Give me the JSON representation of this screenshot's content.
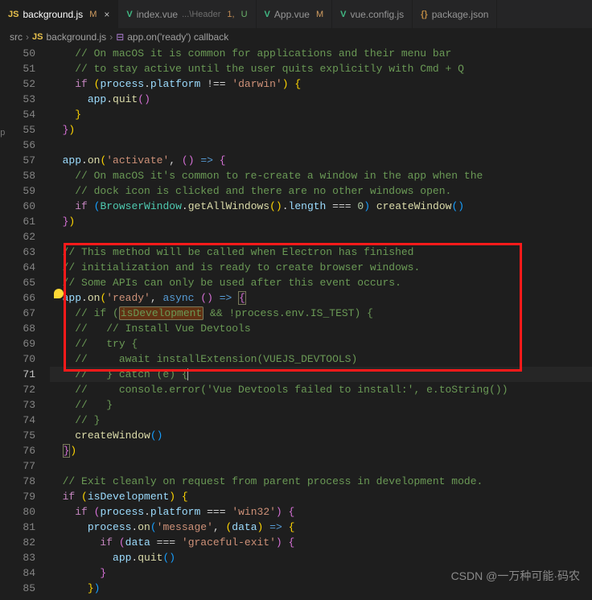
{
  "tabs": [
    {
      "icon": "JS",
      "name": "background.js",
      "badge": "M",
      "close": "×",
      "iconClass": "js-icon",
      "badgeClass": "M"
    },
    {
      "icon": "V",
      "name": "index.vue",
      "dim": "...\\Header",
      "num": "1,",
      "badge": "U",
      "iconClass": "vue-icon",
      "badgeClass": "U"
    },
    {
      "icon": "V",
      "name": "App.vue",
      "badge": "M",
      "iconClass": "vue-icon",
      "badgeClass": "M"
    },
    {
      "icon": "V",
      "name": "vue.config.js",
      "iconClass": "vue-icon"
    },
    {
      "icon": "{}",
      "name": "package.json",
      "iconClass": "json-icon"
    }
  ],
  "breadcrumbs": {
    "seg1": "src",
    "seg2_icon": "JS",
    "seg2": "background.js",
    "seg3_icon": "⊟",
    "seg3": "app.on('ready') callback"
  },
  "code": {
    "lines": [
      {
        "n": 50,
        "html": "    <span class='c-comment'>// On macOS it is common for applications and their menu bar</span>"
      },
      {
        "n": 51,
        "html": "    <span class='c-comment'>// to stay active until the user quits explicitly with Cmd + Q</span>"
      },
      {
        "n": 52,
        "html": "    <span class='c-keyword'>if</span> <span class='c-br'>(</span><span class='c-var'>process</span>.<span class='c-prop'>platform</span> !== <span class='c-string'>'darwin'</span><span class='c-br'>)</span> <span class='c-br'>{</span>"
      },
      {
        "n": 53,
        "html": "      <span class='c-var'>app</span>.<span class='c-func'>quit</span><span class='c-br2'>(</span><span class='c-br2'>)</span>"
      },
      {
        "n": 54,
        "html": "    <span class='c-br'>}</span>"
      },
      {
        "n": 55,
        "html": "  <span class='c-br2'>}</span><span class='c-br'>)</span>"
      },
      {
        "n": 56,
        "html": ""
      },
      {
        "n": 57,
        "html": "  <span class='c-var'>app</span>.<span class='c-func'>on</span><span class='c-br'>(</span><span class='c-string'>'activate'</span>, <span class='c-br2'>(</span><span class='c-br2'>)</span> <span class='c-const'>=&gt;</span> <span class='c-br2'>{</span>"
      },
      {
        "n": 58,
        "html": "    <span class='c-comment'>// On macOS it's common to re-create a window in the app when the</span>"
      },
      {
        "n": 59,
        "html": "    <span class='c-comment'>// dock icon is clicked and there are no other windows open.</span>"
      },
      {
        "n": 60,
        "html": "    <span class='c-keyword'>if</span> <span class='c-br3'>(</span><span class='c-obj'>BrowserWindow</span>.<span class='c-func'>getAllWindows</span><span class='c-br'>(</span><span class='c-br'>)</span>.<span class='c-prop'>length</span> === <span class='c-num'>0</span><span class='c-br3'>)</span> <span class='c-func'>createWindow</span><span class='c-br3'>(</span><span class='c-br3'>)</span>"
      },
      {
        "n": 61,
        "html": "  <span class='c-br2'>}</span><span class='c-br'>)</span>"
      },
      {
        "n": 62,
        "html": ""
      },
      {
        "n": 63,
        "html": "  <span class='c-comment'>// This method will be called when Electron has finished</span>"
      },
      {
        "n": 64,
        "html": "  <span class='c-comment'>// initialization and is ready to create browser windows.</span>"
      },
      {
        "n": 65,
        "html": "  <span class='c-comment'>// Some APIs can only be used after this event occurs.</span>"
      },
      {
        "n": 66,
        "html": "  <span class='c-var'>app</span>.<span class='c-func'>on</span><span class='c-br'>(</span><span class='c-string'>'ready'</span>, <span class='c-const'>async</span> <span class='c-br2'>(</span><span class='c-br2'>)</span> <span class='c-const'>=&gt;</span> <span class='c-br2' style='border:1px solid #7a7a5a;'>{</span>"
      },
      {
        "n": 67,
        "html": "    <span class='c-comment'>// if (<span class='hl-box'>isDevelopment</span> && !process.env.IS_TEST) {</span>"
      },
      {
        "n": 68,
        "html": "    <span class='c-comment'>//   // Install Vue Devtools</span>"
      },
      {
        "n": 69,
        "html": "    <span class='c-comment'>//   try {</span>"
      },
      {
        "n": 70,
        "html": "    <span class='c-comment'>//     await installExtension(VUEJS_DEVTOOLS)</span>"
      },
      {
        "n": 71,
        "html": "    <span class='c-comment'>//   } catch (e) {</span><span class='cursor'></span>",
        "active": true
      },
      {
        "n": 72,
        "html": "    <span class='c-comment'>//     console.error('Vue Devtools failed to install:', e.toString())</span>"
      },
      {
        "n": 73,
        "html": "    <span class='c-comment'>//   }</span>"
      },
      {
        "n": 74,
        "html": "    <span class='c-comment'>// }</span>"
      },
      {
        "n": 75,
        "html": "    <span class='c-func'>createWindow</span><span class='c-br3'>(</span><span class='c-br3'>)</span>"
      },
      {
        "n": 76,
        "html": "  <span class='c-br2' style='border:1px solid #7a7a5a;'>}</span><span class='c-br'>)</span>"
      },
      {
        "n": 77,
        "html": ""
      },
      {
        "n": 78,
        "html": "  <span class='c-comment'>// Exit cleanly on request from parent process in development mode.</span>"
      },
      {
        "n": 79,
        "html": "  <span class='c-keyword'>if</span> <span class='c-br'>(</span><span class='c-var'>isDevelopment</span><span class='c-br'>)</span> <span class='c-br'>{</span>"
      },
      {
        "n": 80,
        "html": "    <span class='c-keyword'>if</span> <span class='c-br2'>(</span><span class='c-var'>process</span>.<span class='c-prop'>platform</span> === <span class='c-string'>'win32'</span><span class='c-br2'>)</span> <span class='c-br2'>{</span>"
      },
      {
        "n": 81,
        "html": "      <span class='c-var'>process</span>.<span class='c-func'>on</span><span class='c-br3'>(</span><span class='c-string'>'message'</span>, <span class='c-br'>(</span><span class='c-param'>data</span><span class='c-br'>)</span> <span class='c-const'>=&gt;</span> <span class='c-br'>{</span>"
      },
      {
        "n": 82,
        "html": "        <span class='c-keyword'>if</span> <span class='c-br2'>(</span><span class='c-var'>data</span> === <span class='c-string'>'graceful-exit'</span><span class='c-br2'>)</span> <span class='c-br2'>{</span>"
      },
      {
        "n": 83,
        "html": "          <span class='c-var'>app</span>.<span class='c-func'>quit</span><span class='c-br3'>(</span><span class='c-br3'>)</span>"
      },
      {
        "n": 84,
        "html": "        <span class='c-br2'>}</span>"
      },
      {
        "n": 85,
        "html": "      <span class='c-br'>}</span><span class='c-br3'>)</span>"
      }
    ]
  },
  "watermark": "CSDN @一万种可能·码农",
  "sideSliver": "p"
}
